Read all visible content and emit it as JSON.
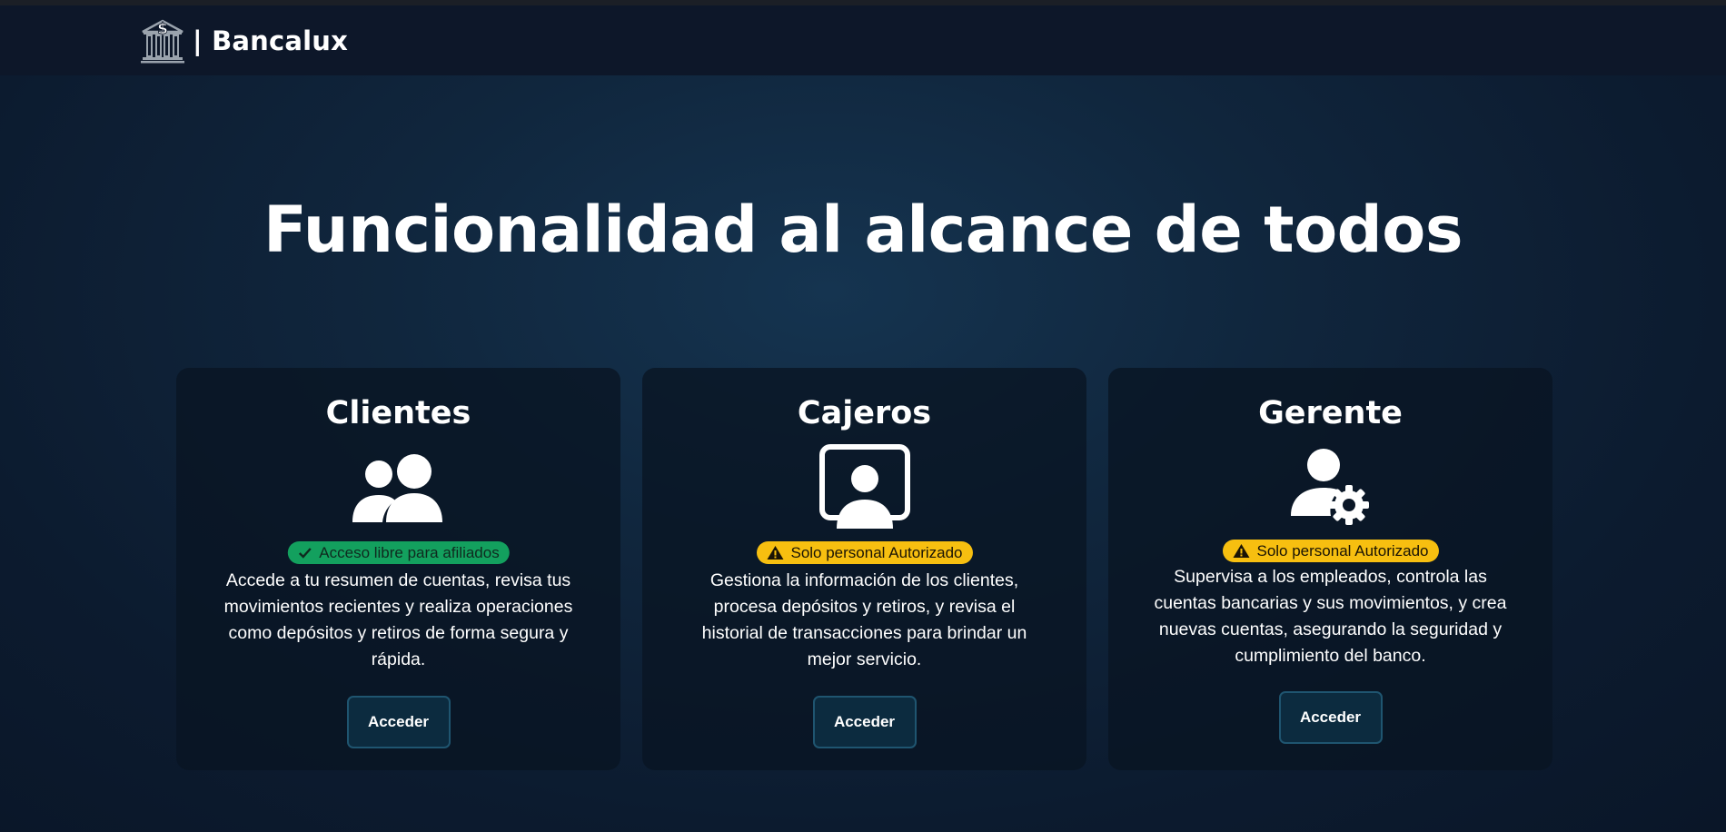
{
  "brand": {
    "name": "| Bancalux",
    "icon": "bank-icon"
  },
  "hero": {
    "title": "Funcionalidad al alcance de todos"
  },
  "colors": {
    "badge_green": "#13a05e",
    "badge_yellow": "#f7bf10",
    "button_bg": "#0c2b3f",
    "button_border": "#1f5570"
  },
  "cards": [
    {
      "title": "Clientes",
      "icon": "users-icon",
      "badge": {
        "text": "Acceso libre para afiliados",
        "icon": "check-icon",
        "status": "green"
      },
      "description": "Accede a tu resumen de cuentas, revisa tus movimientos recientes y realiza operaciones como depósitos y retiros de forma segura y rápida.",
      "button": "Acceder"
    },
    {
      "title": "Cajeros",
      "icon": "screen-user-icon",
      "badge": {
        "text": "Solo personal Autorizado",
        "icon": "warning-icon",
        "status": "yellow"
      },
      "description": "Gestiona la información de los clientes, procesa depósitos y retiros, y revisa el historial de transacciones para brindar un mejor servicio.",
      "button": "Acceder"
    },
    {
      "title": "Gerente",
      "icon": "user-gear-icon",
      "badge": {
        "text": "Solo personal Autorizado",
        "icon": "warning-icon",
        "status": "yellow"
      },
      "description": "Supervisa a los empleados, controla las cuentas bancarias y sus movimientos, y crea nuevas cuentas, asegurando la seguridad y cumplimiento del banco.",
      "button": "Acceder"
    }
  ]
}
